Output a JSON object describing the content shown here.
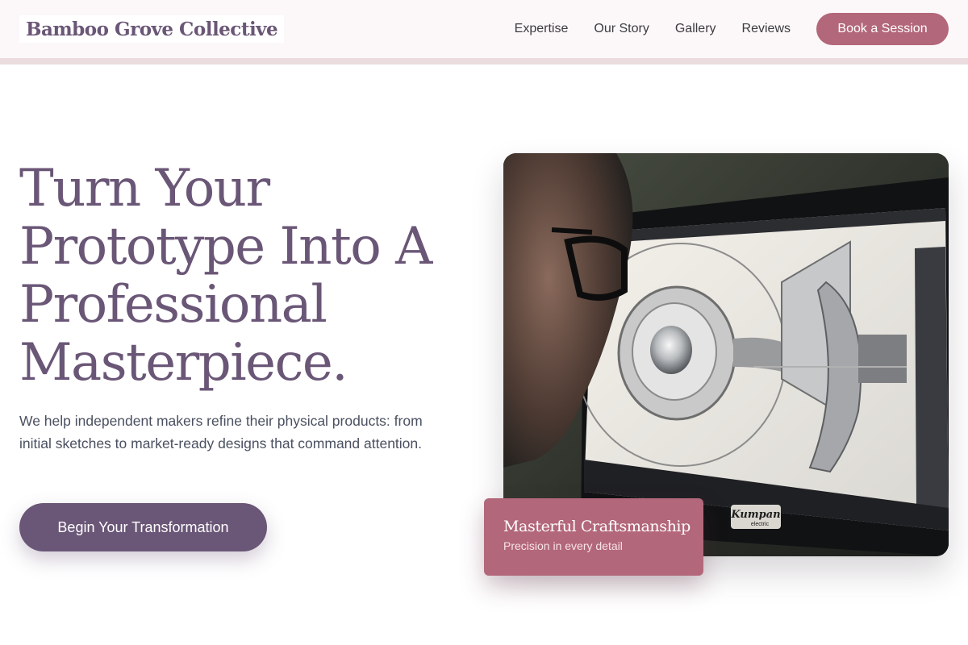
{
  "header": {
    "logo_text": "Bamboo Grove Collective",
    "nav": [
      {
        "label": "Expertise"
      },
      {
        "label": "Our Story"
      },
      {
        "label": "Gallery"
      },
      {
        "label": "Reviews"
      }
    ],
    "cta_label": "Book a Session"
  },
  "hero": {
    "title": "Turn Your Prototype Into A Professional Masterpiece.",
    "description": "We help independent makers refine their physical products: from initial sketches to market-ready designs that command attention.",
    "cta_label": "Begin Your Transformation",
    "image": {
      "subject": "designer-at-monitor-photo",
      "monitor_brand": "Kumpan",
      "monitor_brand_sub": "electric"
    },
    "badge": {
      "title": "Masterful Craftsmanship",
      "subtitle": "Precision in every detail"
    }
  },
  "colors": {
    "primary": "#6a5676",
    "accent": "#b3677a",
    "header_bg": "#fcf8f9",
    "header_border": "#ebdcdf"
  }
}
